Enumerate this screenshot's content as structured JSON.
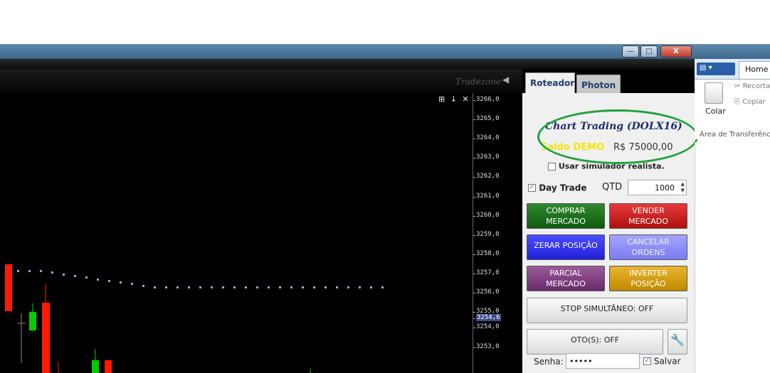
{
  "window": {
    "minimize_label": "—",
    "restore_label": "□",
    "close_label": "X"
  },
  "header": {
    "watermark": "Tradezone",
    "chart_controls": "⊞ ↓ ✕"
  },
  "price_axis": {
    "labels": [
      "3266,0",
      "3265,0",
      "3264,0",
      "3263,0",
      "3262,0",
      "3261,0",
      "3260,0",
      "3259,0",
      "3258,0",
      "3257,0",
      "3256,0",
      "3255,0",
      "3254,6",
      "3254,0",
      "3253,0"
    ],
    "current_price": "3254,6"
  },
  "tabs": [
    {
      "label": "Roteador",
      "active": true
    },
    {
      "label": "Photon",
      "active": false
    }
  ],
  "order_panel": {
    "title": "Chart Trading  (DOLX16)",
    "balance_label": "Saldo DEMO",
    "balance_value": "R$ 75000,00",
    "realistic_sim_label": "Usar simulador realista.",
    "day_trade_label": "Day Trade",
    "qtd_label": "QTD",
    "qtd_value": "1000",
    "buttons": {
      "buy_market": "COMPRAR\nMERCADO",
      "sell_market": "VENDER\nMERCADO",
      "zero_position": "ZERAR POSIÇÃO",
      "cancel_orders": "CANCELAR\nORDENS",
      "partial_market": "PARCIAL\nMERCADO",
      "invert_position": "INVERTER\nPOSIÇÃO",
      "stop_simultaneous": "STOP SIMULTÂNEO: OFF",
      "oto": "OTO(S): OFF"
    },
    "password_label": "Senha:",
    "password_value": "•••••",
    "save_label": "Salvar",
    "colors": {
      "buy": "#1a6e1a",
      "sell": "#d01818",
      "zero": "#2f2fee",
      "cancel": "#8f8ff5",
      "partial": "#8a4a8a",
      "invert": "#d9a21a"
    }
  },
  "ribbon": {
    "file_label": "▤ ▾",
    "home_tab": "Home",
    "paste_label": "Colar",
    "cut_label": "Recorta",
    "copy_label": "Copiar",
    "group_label": "Área de Transferênc"
  }
}
